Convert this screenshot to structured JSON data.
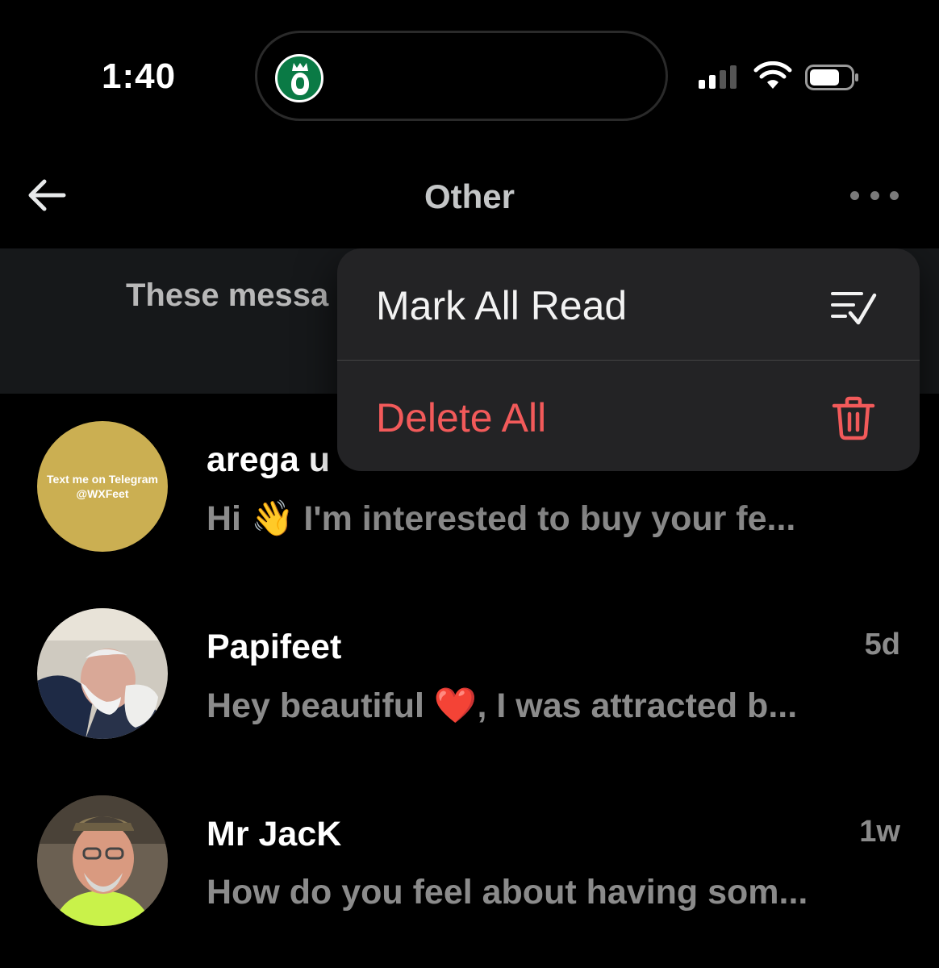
{
  "status_bar": {
    "time": "1:40",
    "live_activity_icon": "starbucks-logo",
    "signal_icon": "cellular-signal-icon",
    "wifi_icon": "wifi-icon",
    "battery_icon": "battery-icon"
  },
  "header": {
    "title": "Other",
    "back_icon": "arrow-left-icon",
    "more_icon": "ellipsis-icon"
  },
  "banner": {
    "text": "These messa"
  },
  "menu": {
    "items": [
      {
        "label": "Mark All Read",
        "icon": "checklist-icon",
        "color": "#f2f2f2"
      },
      {
        "label": "Delete All",
        "icon": "trash-icon",
        "color": "#f25a5a"
      }
    ]
  },
  "conversations": [
    {
      "name": "arega u",
      "timestamp": "",
      "preview": "Hi 👋 I'm interested to buy your fe...",
      "avatar_text": [
        "Text me on Telegram",
        "@WXFeet"
      ]
    },
    {
      "name": "Papifeet",
      "timestamp": "5d",
      "preview": "Hey beautiful ❤️, I was attracted b..."
    },
    {
      "name": "Mr JacK",
      "timestamp": "1w",
      "preview": "How do you feel about having som..."
    }
  ],
  "colors": {
    "background": "#000000",
    "banner": "#16181a",
    "menu": "#232325",
    "destructive": "#f25a5a",
    "secondary_text": "#8b8b8b"
  }
}
